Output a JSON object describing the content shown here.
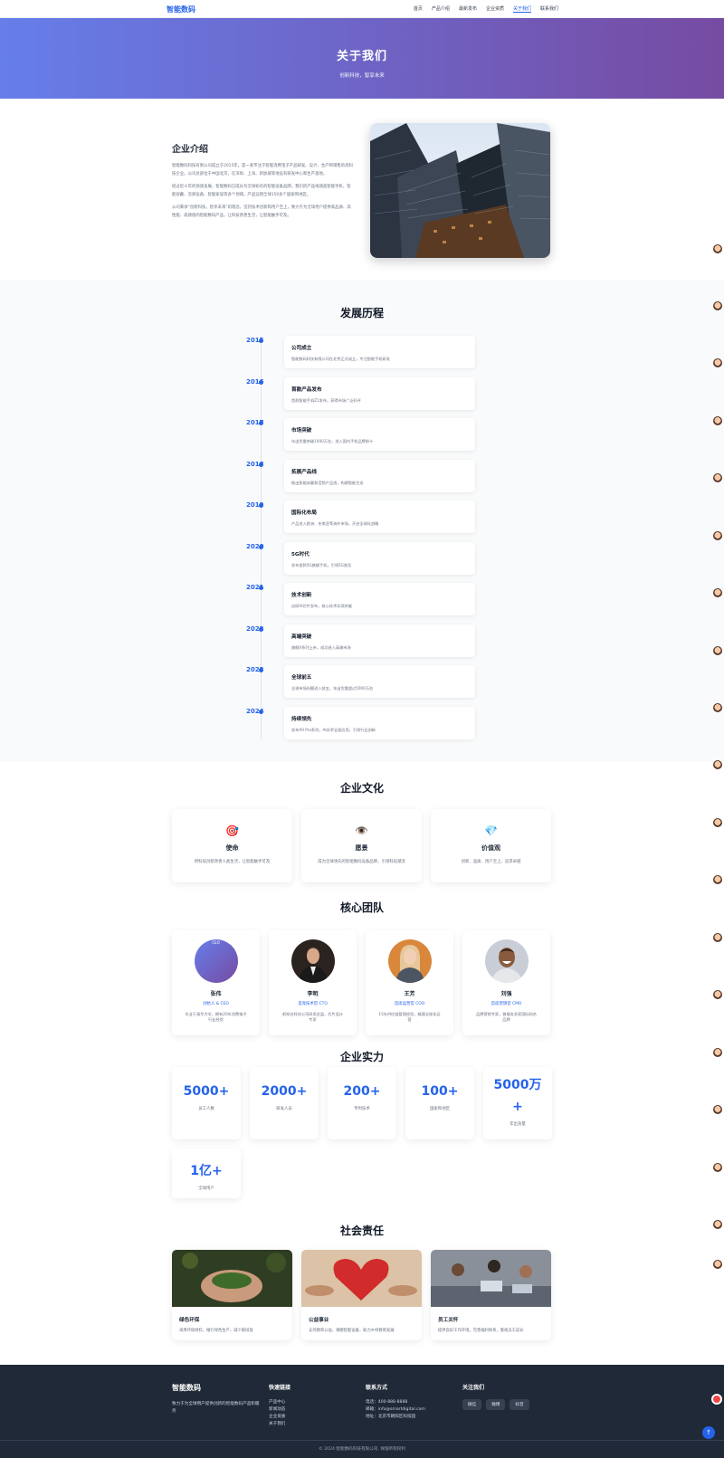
{
  "nav": {
    "logo": "智能数码",
    "items": [
      "首页",
      "产品介绍",
      "最新发布",
      "企业资质",
      "关于我们",
      "联系我们"
    ],
    "active_index": 4
  },
  "hero": {
    "title": "关于我们",
    "subtitle": "创新科技，智享未来"
  },
  "intro": {
    "title": "企业介绍",
    "paragraphs": [
      "智能数码科技有限公司成立于2015年，是一家专注于智能消费电子产品研发、设计、生产和销售的高科技企业。公司总部位于中国北京，在深圳、上海、新加坡等地设有研发中心和生产基地。",
      "经过近十年的快速发展，智能数码已成长为全球知名的智能设备品牌。我们的产品线涵盖智能手机、智能穿戴、音频设备、智能家居等多个领域，产品远销全球150多个国家和地区。",
      "公司秉承“创新科技，智享未来”的理念，坚持技术创新和用户至上，致力于为全球用户提供高品质、高性能、高颜值的智能数码产品，让科技改善生活，让智能触手可及。"
    ]
  },
  "history": {
    "title": "发展历程",
    "items": [
      {
        "year": "2015",
        "title": "公司成立",
        "desc": "智能数码科技有限公司在北京正式成立，专注智能手机研发"
      },
      {
        "year": "2016",
        "title": "首款产品发布",
        "desc": "首款智能手机Z1发布，获得市场广泛好评"
      },
      {
        "year": "2017",
        "title": "市场突破",
        "desc": "年出货量突破1000万台，进入国内手机品牌前十"
      },
      {
        "year": "2018",
        "title": "拓展产品线",
        "desc": "推出智能穿戴和音频产品线，构建智能生态"
      },
      {
        "year": "2019",
        "title": "国际化布局",
        "desc": "产品进入欧洲、东南亚等海外市场，开启全球化战略"
      },
      {
        "year": "2020",
        "title": "5G时代",
        "desc": "发布首款5G旗舰手机，引领5G普及"
      },
      {
        "year": "2021",
        "title": "技术创新",
        "desc": "自研AI芯片发布，核心技术实现突破"
      },
      {
        "year": "2022",
        "title": "高端突破",
        "desc": "旗舰X系列上市，成功进入高端市场"
      },
      {
        "year": "2023",
        "title": "全球前五",
        "desc": "全球市场份额进入前五，年出货量超过5000万台"
      },
      {
        "year": "2024",
        "title": "持续领先",
        "desc": "发布X9 Pro系列，AI技术全面应用，引领行业创新"
      }
    ]
  },
  "culture": {
    "title": "企业文化",
    "cards": [
      {
        "icon": "target-icon",
        "glyph": "🎯",
        "title": "使命",
        "desc": "用科技创新改善人类生活，让智能触手可及"
      },
      {
        "icon": "eye-icon",
        "glyph": "👁️",
        "title": "愿景",
        "desc": "成为全球领先的智能数码设备品牌，引领科技潮流"
      },
      {
        "icon": "diamond-icon",
        "glyph": "💎",
        "title": "价值观",
        "desc": "创新、品质、用户至上、追求卓越"
      }
    ]
  },
  "team": {
    "title": "核心团队",
    "members": [
      {
        "name": "张伟",
        "role": "创始人 & CEO",
        "desc": "毕业于清华大学，拥有20年消费电子行业经验",
        "avatar": "CEO"
      },
      {
        "name": "李明",
        "role": "首席技术官 CTO",
        "desc": "前知名科技公司研发总监，芯片设计专家",
        "avatar": ""
      },
      {
        "name": "王芳",
        "role": "首席运营官 COO",
        "desc": "15年供应链管理经验，精通全球化运营",
        "avatar": ""
      },
      {
        "name": "刘强",
        "role": "首席营销官 CMO",
        "desc": "品牌营销专家，曾服务多家国际知名品牌",
        "avatar": ""
      }
    ]
  },
  "stats": {
    "title": "企业实力",
    "items": [
      {
        "num": "5000+",
        "label": "员工人数"
      },
      {
        "num": "2000+",
        "label": "研发人员"
      },
      {
        "num": "200+",
        "label": "专利技术"
      },
      {
        "num": "100+",
        "label": "国家和地区"
      },
      {
        "num": "5000万+",
        "label": "年出货量"
      },
      {
        "num": "1亿+",
        "label": "全球用户"
      }
    ]
  },
  "social": {
    "title": "社会责任",
    "cards": [
      {
        "title": "绿色环保",
        "desc": "采用环保材料，推行绿色生产，减少碳排放"
      },
      {
        "title": "公益事业",
        "desc": "支持教育公益，捐赠智能设备，助力乡村教育发展"
      },
      {
        "title": "员工关怀",
        "desc": "提供良好工作环境，完善福利体系，重视员工成长"
      }
    ]
  },
  "footer": {
    "brand": "智能数码",
    "brand_desc": "致力于为全球用户提供创新的智能数码产品和服务",
    "quick_title": "快速链接",
    "quick_links": [
      "产品中心",
      "新闻动态",
      "企业资质",
      "关于我们"
    ],
    "contact_title": "联系方式",
    "contact": [
      "电话：400-888-8888",
      "邮箱：info@smartdigital.com",
      "地址：北京市朝阳区科技园"
    ],
    "follow_title": "关注我们",
    "follow": [
      "微信",
      "微博",
      "抖音"
    ],
    "copyright": "© 2024 智能数码科技有限公司. 保留所有权利"
  },
  "colors": {
    "accent": "#2563eb",
    "hero_start": "#667eea",
    "hero_end": "#764ba2",
    "footer_bg": "#1f2937"
  }
}
